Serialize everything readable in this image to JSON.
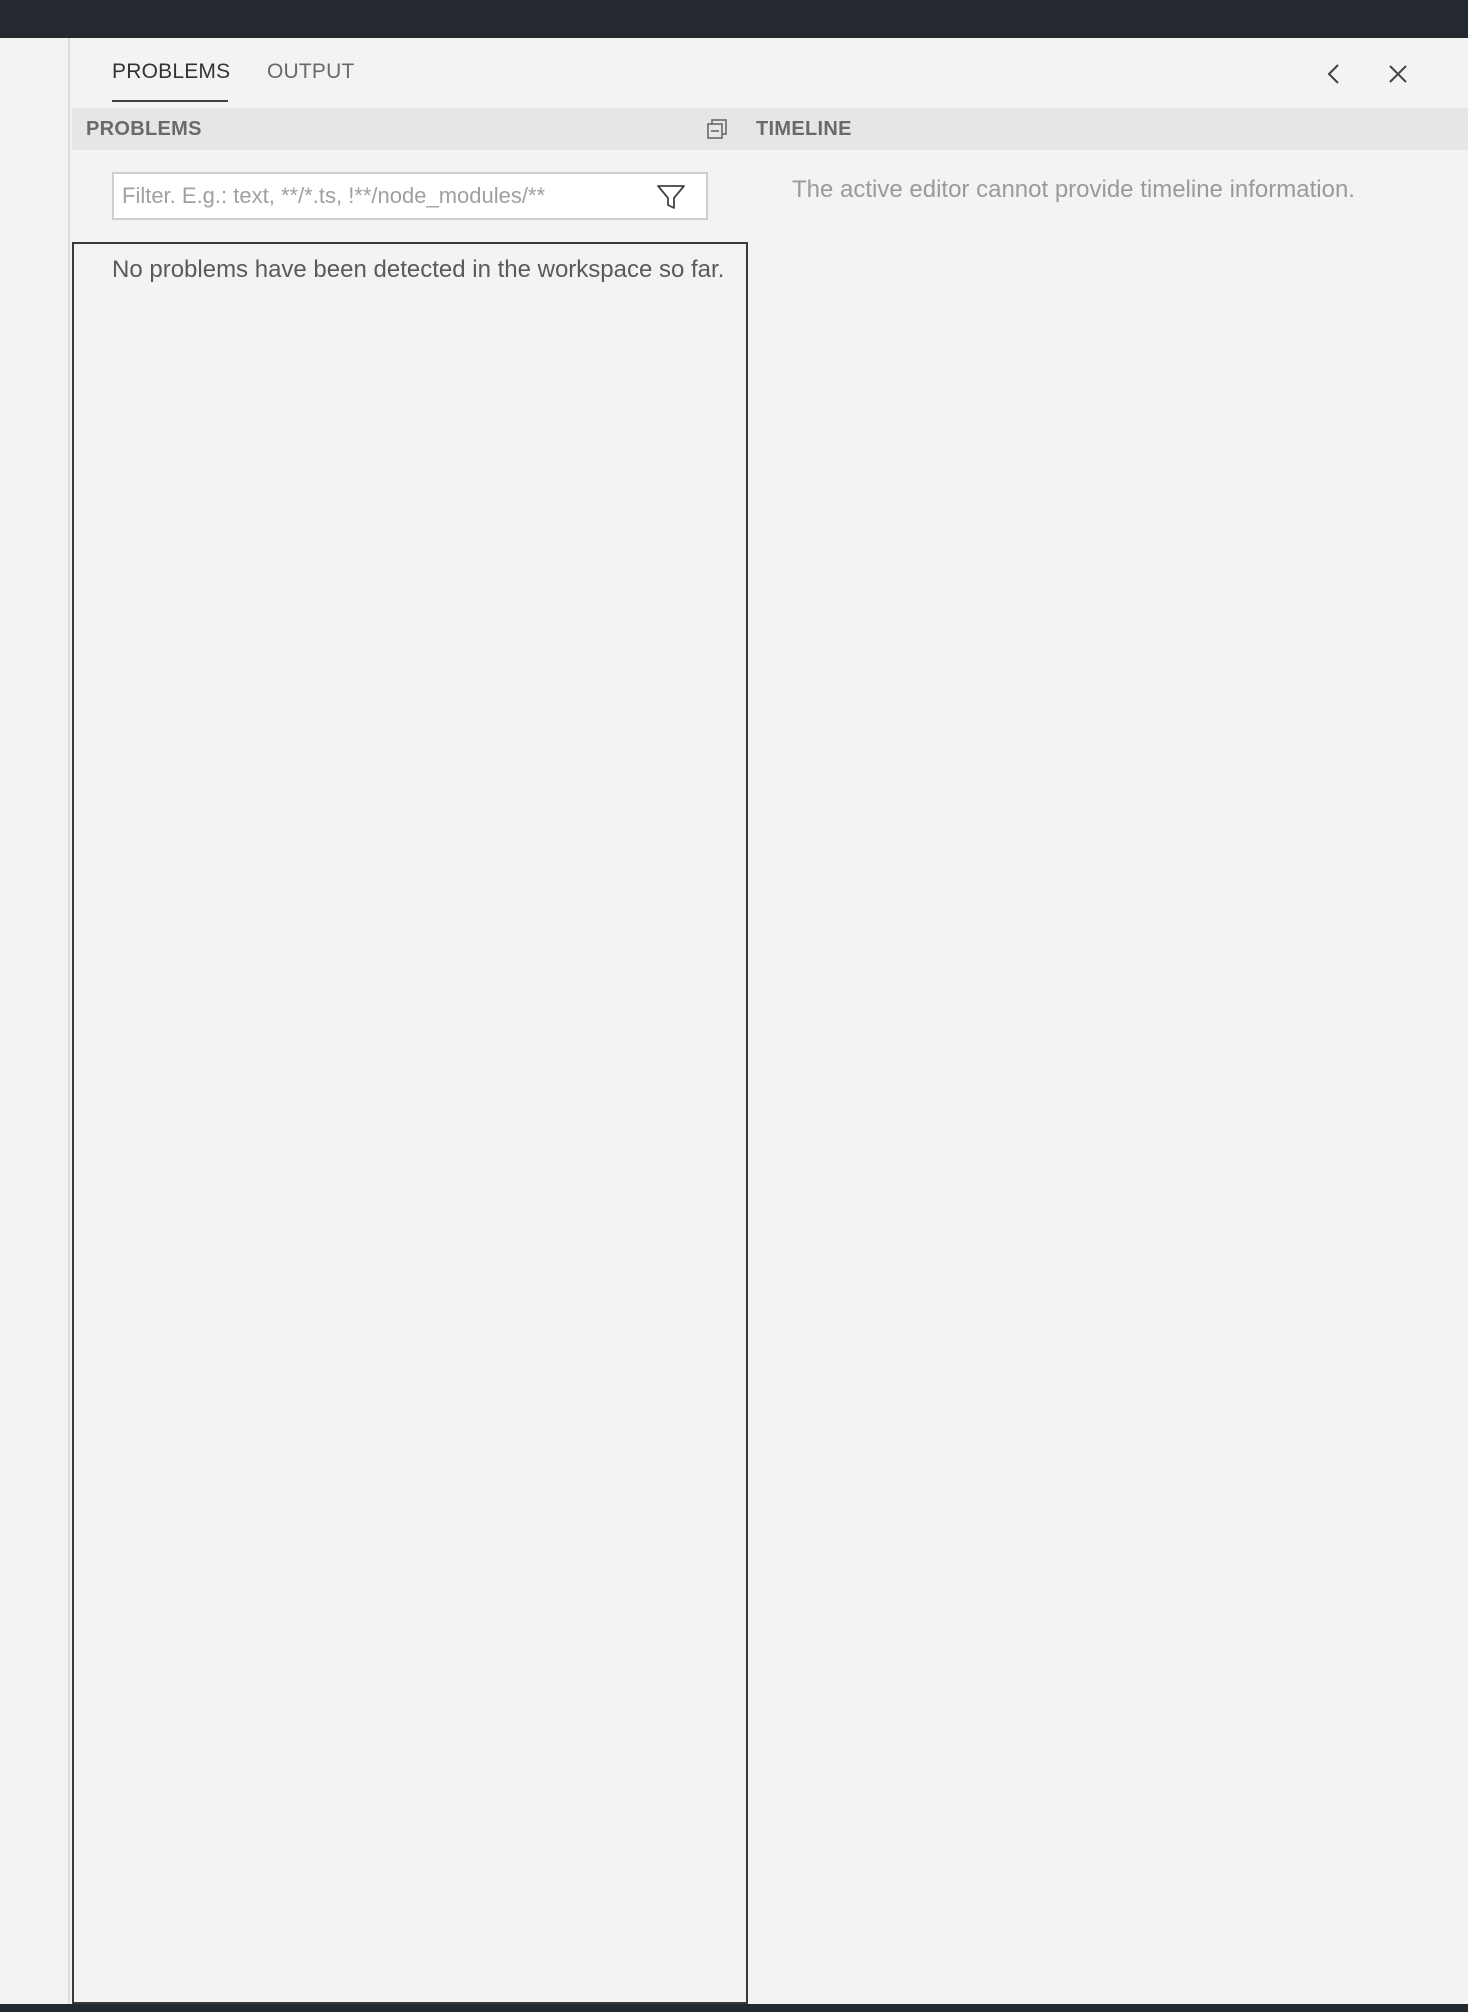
{
  "panel": {
    "tabs": [
      {
        "label": "PROBLEMS",
        "active": true
      },
      {
        "label": "OUTPUT",
        "active": false
      }
    ],
    "actions": {
      "back_icon": "chevron-left-icon",
      "close_icon": "close-icon"
    }
  },
  "problems": {
    "title": "PROBLEMS",
    "collapse_icon": "collapse-all-icon",
    "filter": {
      "placeholder": "Filter. E.g.: text, **/*.ts, !**/node_modules/**",
      "value": "",
      "icon": "filter-icon"
    },
    "empty_message": "No problems have been detected in the workspace so far."
  },
  "timeline": {
    "title": "TIMELINE",
    "message": "The active editor cannot provide timeline information."
  },
  "colors": {
    "titlebar": "#24292f",
    "panel_background": "#f3f3f3",
    "section_header": "#e6e6e6"
  }
}
